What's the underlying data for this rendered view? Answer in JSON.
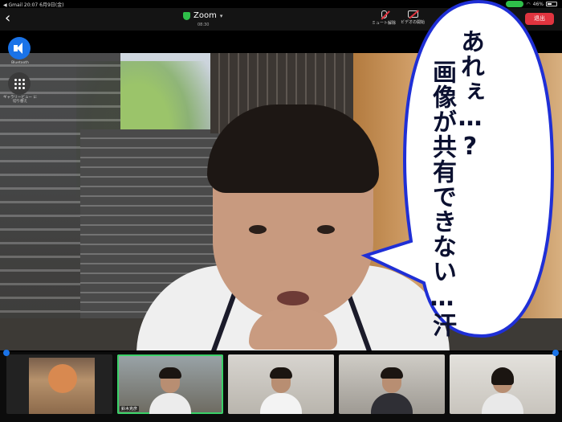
{
  "status_bar": {
    "left_text": "◀ Gmail  20:07  6月9日(金)",
    "battery": "46%"
  },
  "topbar": {
    "title": "Zoom",
    "time": "08:30",
    "mute_label": "ミュート解除",
    "video_label": "ビデオの開始",
    "leave_label": "退出"
  },
  "side": {
    "bluetooth_label": "Bluetooth",
    "gallery_label": "ギャラリービュー に切り替え"
  },
  "bubble": {
    "line1": "あれぇ…?",
    "line2": "画像が共有できない…汗"
  },
  "thumbnails": [
    {
      "name": "",
      "active": false
    },
    {
      "name": "鈴木克彦",
      "active": true
    },
    {
      "name": "",
      "active": false
    },
    {
      "name": "",
      "active": false
    },
    {
      "name": "",
      "active": false
    }
  ],
  "colors": {
    "accent": "#1a73e8",
    "leave": "#e0343f",
    "active_speaker": "#3ad168",
    "bubble_border": "#1f2fd6"
  }
}
